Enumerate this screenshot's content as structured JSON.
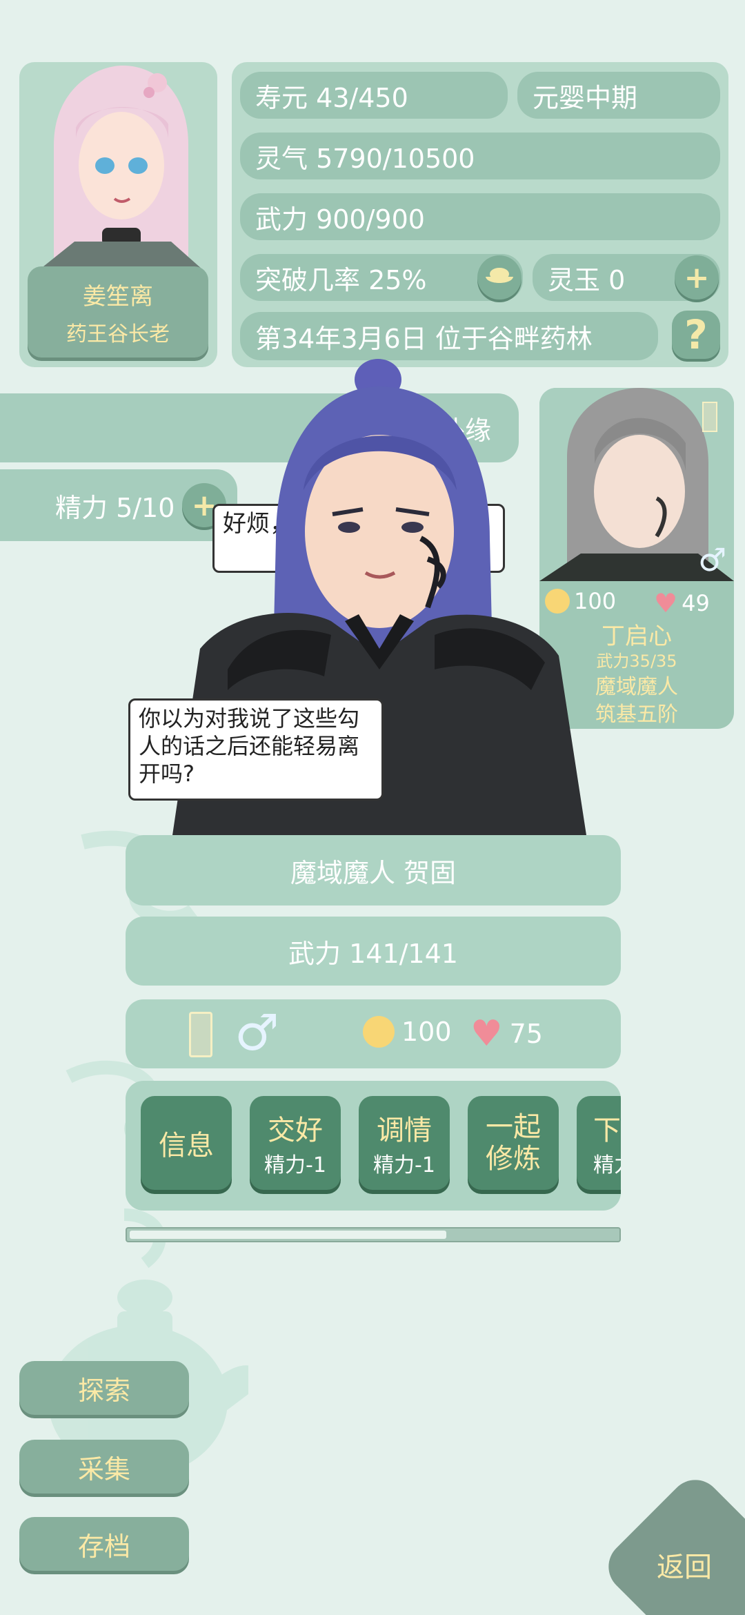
{
  "player": {
    "name": "姜笙离",
    "title": "药王谷长老",
    "lifespan": "寿元 43/450",
    "realm": "元婴中期",
    "qi": "灵气 5790/10500",
    "force": "武力 900/900",
    "breakthrough": "突破几率 25%",
    "jade": "灵玉 0",
    "date_location": "第34年3月6日 位于谷畔药林"
  },
  "left_panel": {
    "tab_label": "外缘",
    "energy": "精力 5/10"
  },
  "npc_card": {
    "mood": "100",
    "affection": "49",
    "name": "丁启心",
    "force": "武力35/35",
    "faction": "魔域魔人",
    "realm": "筑基五阶"
  },
  "dialogue": {
    "bubble_back": "好烦，……下能杀人了",
    "bubble_main": "你以为对我说了这些勾人的话之后还能轻易离开吗?"
  },
  "target": {
    "name_line": "魔域魔人 贺固",
    "force": "武力 141/141",
    "mood": "100",
    "affection": "75"
  },
  "actions": [
    {
      "label": "信息",
      "sub": ""
    },
    {
      "label": "交好",
      "sub": "精力-1"
    },
    {
      "label": "调情",
      "sub": "精力-1"
    },
    {
      "label": "一起修炼",
      "sub": ""
    },
    {
      "label": "下",
      "sub": "精力"
    }
  ],
  "side_menu": {
    "explore": "探索",
    "gather": "采集",
    "save": "存档"
  },
  "return_label": "返回",
  "scroll_progress": 0.65,
  "colors": {
    "background": "#e4f1ec",
    "pill": "#9cc5b3",
    "button_green": "#4f8a6d",
    "button_text": "#fbe9a6",
    "heart": "#f08c98"
  }
}
